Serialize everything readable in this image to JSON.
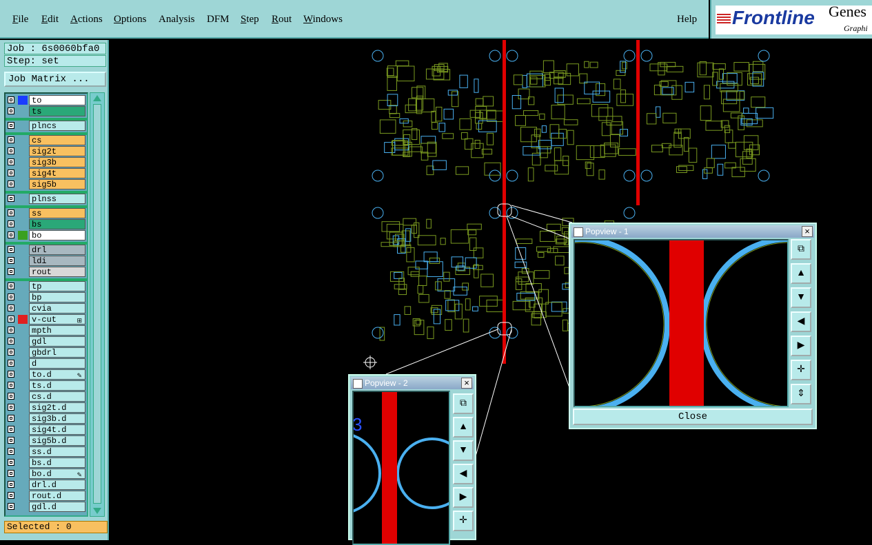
{
  "menu": {
    "file": "File",
    "edit": "Edit",
    "actions": "Actions",
    "options": "Options",
    "analysis": "Analysis",
    "dfm": "DFM",
    "step": "Step",
    "rout": "Rout",
    "windows": "Windows",
    "help": "Help"
  },
  "logo": {
    "brand": "Frontline",
    "product": "Genes",
    "sub": "Graphi"
  },
  "job": {
    "label": "Job : 6s0060bfa0",
    "step": "Step: set",
    "matrix_button": "Job Matrix ..."
  },
  "layers": [
    {
      "name": "to",
      "color": "#ffffff",
      "swatch": "#1a3cff"
    },
    {
      "name": "ts",
      "color": "#2aa878",
      "swatch": ""
    },
    {
      "name": "plncs",
      "color": "#b8eaea",
      "swatch": ""
    },
    {
      "name": "cs",
      "color": "#f8c060",
      "swatch": ""
    },
    {
      "name": "sig2t",
      "color": "#f8c060",
      "swatch": ""
    },
    {
      "name": "sig3b",
      "color": "#f8c060",
      "swatch": ""
    },
    {
      "name": "sig4t",
      "color": "#f8c060",
      "swatch": ""
    },
    {
      "name": "sig5b",
      "color": "#f8c060",
      "swatch": ""
    },
    {
      "name": "plnss",
      "color": "#b8eaea",
      "swatch": ""
    },
    {
      "name": "ss",
      "color": "#f8c060",
      "swatch": ""
    },
    {
      "name": "bs",
      "color": "#2aa878",
      "swatch": ""
    },
    {
      "name": "bo",
      "color": "#ffffff",
      "swatch": "#3aa020"
    },
    {
      "name": "drl",
      "color": "#a8b8c0",
      "swatch": ""
    },
    {
      "name": "ldi",
      "color": "#a8b8c0",
      "swatch": ""
    },
    {
      "name": "rout",
      "color": "#d8d8d8",
      "swatch": ""
    },
    {
      "name": "tp",
      "color": "#b8eaea",
      "swatch": ""
    },
    {
      "name": "bp",
      "color": "#b8eaea",
      "swatch": ""
    },
    {
      "name": "cvia",
      "color": "#b8eaea",
      "swatch": ""
    },
    {
      "name": "v-cut",
      "color": "#b8eaea",
      "swatch": "#e02020",
      "icon": "⊞"
    },
    {
      "name": "mpth",
      "color": "#b8eaea",
      "swatch": ""
    },
    {
      "name": "gdl",
      "color": "#b8eaea",
      "swatch": ""
    },
    {
      "name": "gbdrl",
      "color": "#b8eaea",
      "swatch": ""
    },
    {
      "name": "d",
      "color": "#b8eaea",
      "swatch": ""
    },
    {
      "name": "to.d",
      "color": "#b8eaea",
      "swatch": "",
      "icon": "✎"
    },
    {
      "name": "ts.d",
      "color": "#b8eaea",
      "swatch": ""
    },
    {
      "name": "cs.d",
      "color": "#b8eaea",
      "swatch": ""
    },
    {
      "name": "sig2t.d",
      "color": "#b8eaea",
      "swatch": ""
    },
    {
      "name": "sig3b.d",
      "color": "#b8eaea",
      "swatch": ""
    },
    {
      "name": "sig4t.d",
      "color": "#b8eaea",
      "swatch": ""
    },
    {
      "name": "sig5b.d",
      "color": "#b8eaea",
      "swatch": ""
    },
    {
      "name": "ss.d",
      "color": "#b8eaea",
      "swatch": ""
    },
    {
      "name": "bs.d",
      "color": "#b8eaea",
      "swatch": ""
    },
    {
      "name": "bo.d",
      "color": "#b8eaea",
      "swatch": "",
      "icon": "✎"
    },
    {
      "name": "drl.d",
      "color": "#b8eaea",
      "swatch": ""
    },
    {
      "name": "rout.d",
      "color": "#b8eaea",
      "swatch": ""
    },
    {
      "name": "gdl.d",
      "color": "#b8eaea",
      "swatch": ""
    }
  ],
  "status": {
    "selected": "Selected : 0"
  },
  "popview1": {
    "title": "Popview - 1",
    "close_label": "Close"
  },
  "popview2": {
    "title": "Popview - 2",
    "partial_text": "3"
  },
  "colors": {
    "panel": "#9ed6d6",
    "trace": "#e00000",
    "pad": "#4ab0f0",
    "board": "#7a9a20"
  }
}
